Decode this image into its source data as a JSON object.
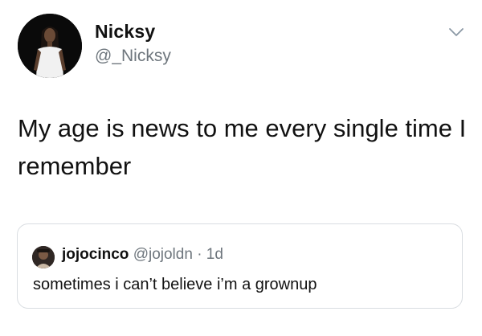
{
  "tweet": {
    "author": {
      "name": "Nicksy",
      "handle": "@_Nicksy",
      "avatar_icon": "profile-photo"
    },
    "text": "My age is news to me every single time I remember",
    "menu_icon": "chevron-down-icon",
    "quoted": {
      "author_name": "jojocinco",
      "author_handle": "@jojoldn",
      "separator": "·",
      "time": "1d",
      "text": "sometimes i can’t believe i’m a grownup",
      "avatar_icon": "profile-photo"
    }
  },
  "colors": {
    "text": "#111111",
    "secondary_text": "#6e767d",
    "border": "#d9dde1",
    "background": "#ffffff"
  }
}
